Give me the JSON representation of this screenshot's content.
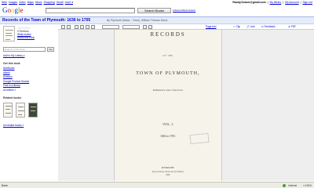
{
  "topnav": {
    "links": [
      "Web",
      "Images",
      "Video",
      "Maps",
      "News",
      "Shopping",
      "Gmail",
      "more ▾"
    ],
    "email": "Randy.Seaver@gmail.com",
    "account_links": [
      "My library",
      "My Account",
      "Sign out"
    ]
  },
  "header": {
    "logo_google": [
      "G",
      "o",
      "o",
      "g",
      "l",
      "e"
    ],
    "logo_books": "books",
    "search_button": "Search Books",
    "advanced_link": "Advanced Book Search"
  },
  "book": {
    "title": "Records of the Town of Plymouth: 1636 to 1705",
    "author_line": "By Plymouth (Mass. : Town), William Thomas Davis"
  },
  "sidebar": {
    "stars": "☆☆☆☆☆",
    "reviews": "0 Reviews",
    "write_review": "Write review",
    "about": "About this book",
    "search_placeholder": "Search in this book",
    "search_button": "Go",
    "add_library": "Add to My Library ▾",
    "get_label": "Get this book",
    "get_links": [
      "AbeBooks",
      "Alibris",
      "Amazon",
      "Google Product Search",
      "Find in a library"
    ],
    "all_sellers": "All sellers »",
    "related_label": "Related books",
    "all_related": "All related books »"
  },
  "toolbar": {
    "zoom_value": "",
    "page_link": "Page text",
    "tools": [
      "Clip",
      "Link",
      "Feedback",
      "PDF"
    ]
  },
  "page": {
    "records": "RECORDS",
    "of_the": "OF THE",
    "town": "TOWN OF PLYMOUTH,",
    "published": "Published by order of the Town.",
    "vol": "VOL. I.",
    "years": "1636 to 1705.",
    "imprint1": "PLYMOUTH:",
    "imprint2": "Avery & Doten, Book and Job Printers.",
    "imprint3": "1889."
  },
  "statusbar": {
    "done": "Done",
    "zone": "Internet",
    "zoom": "▾ 100%"
  },
  "colors": {
    "link": "#0000cc",
    "titlebar_bg": "#e5ecf9",
    "page_bg": "#f6f4ea",
    "viewer_bg": "#eeeeee"
  }
}
